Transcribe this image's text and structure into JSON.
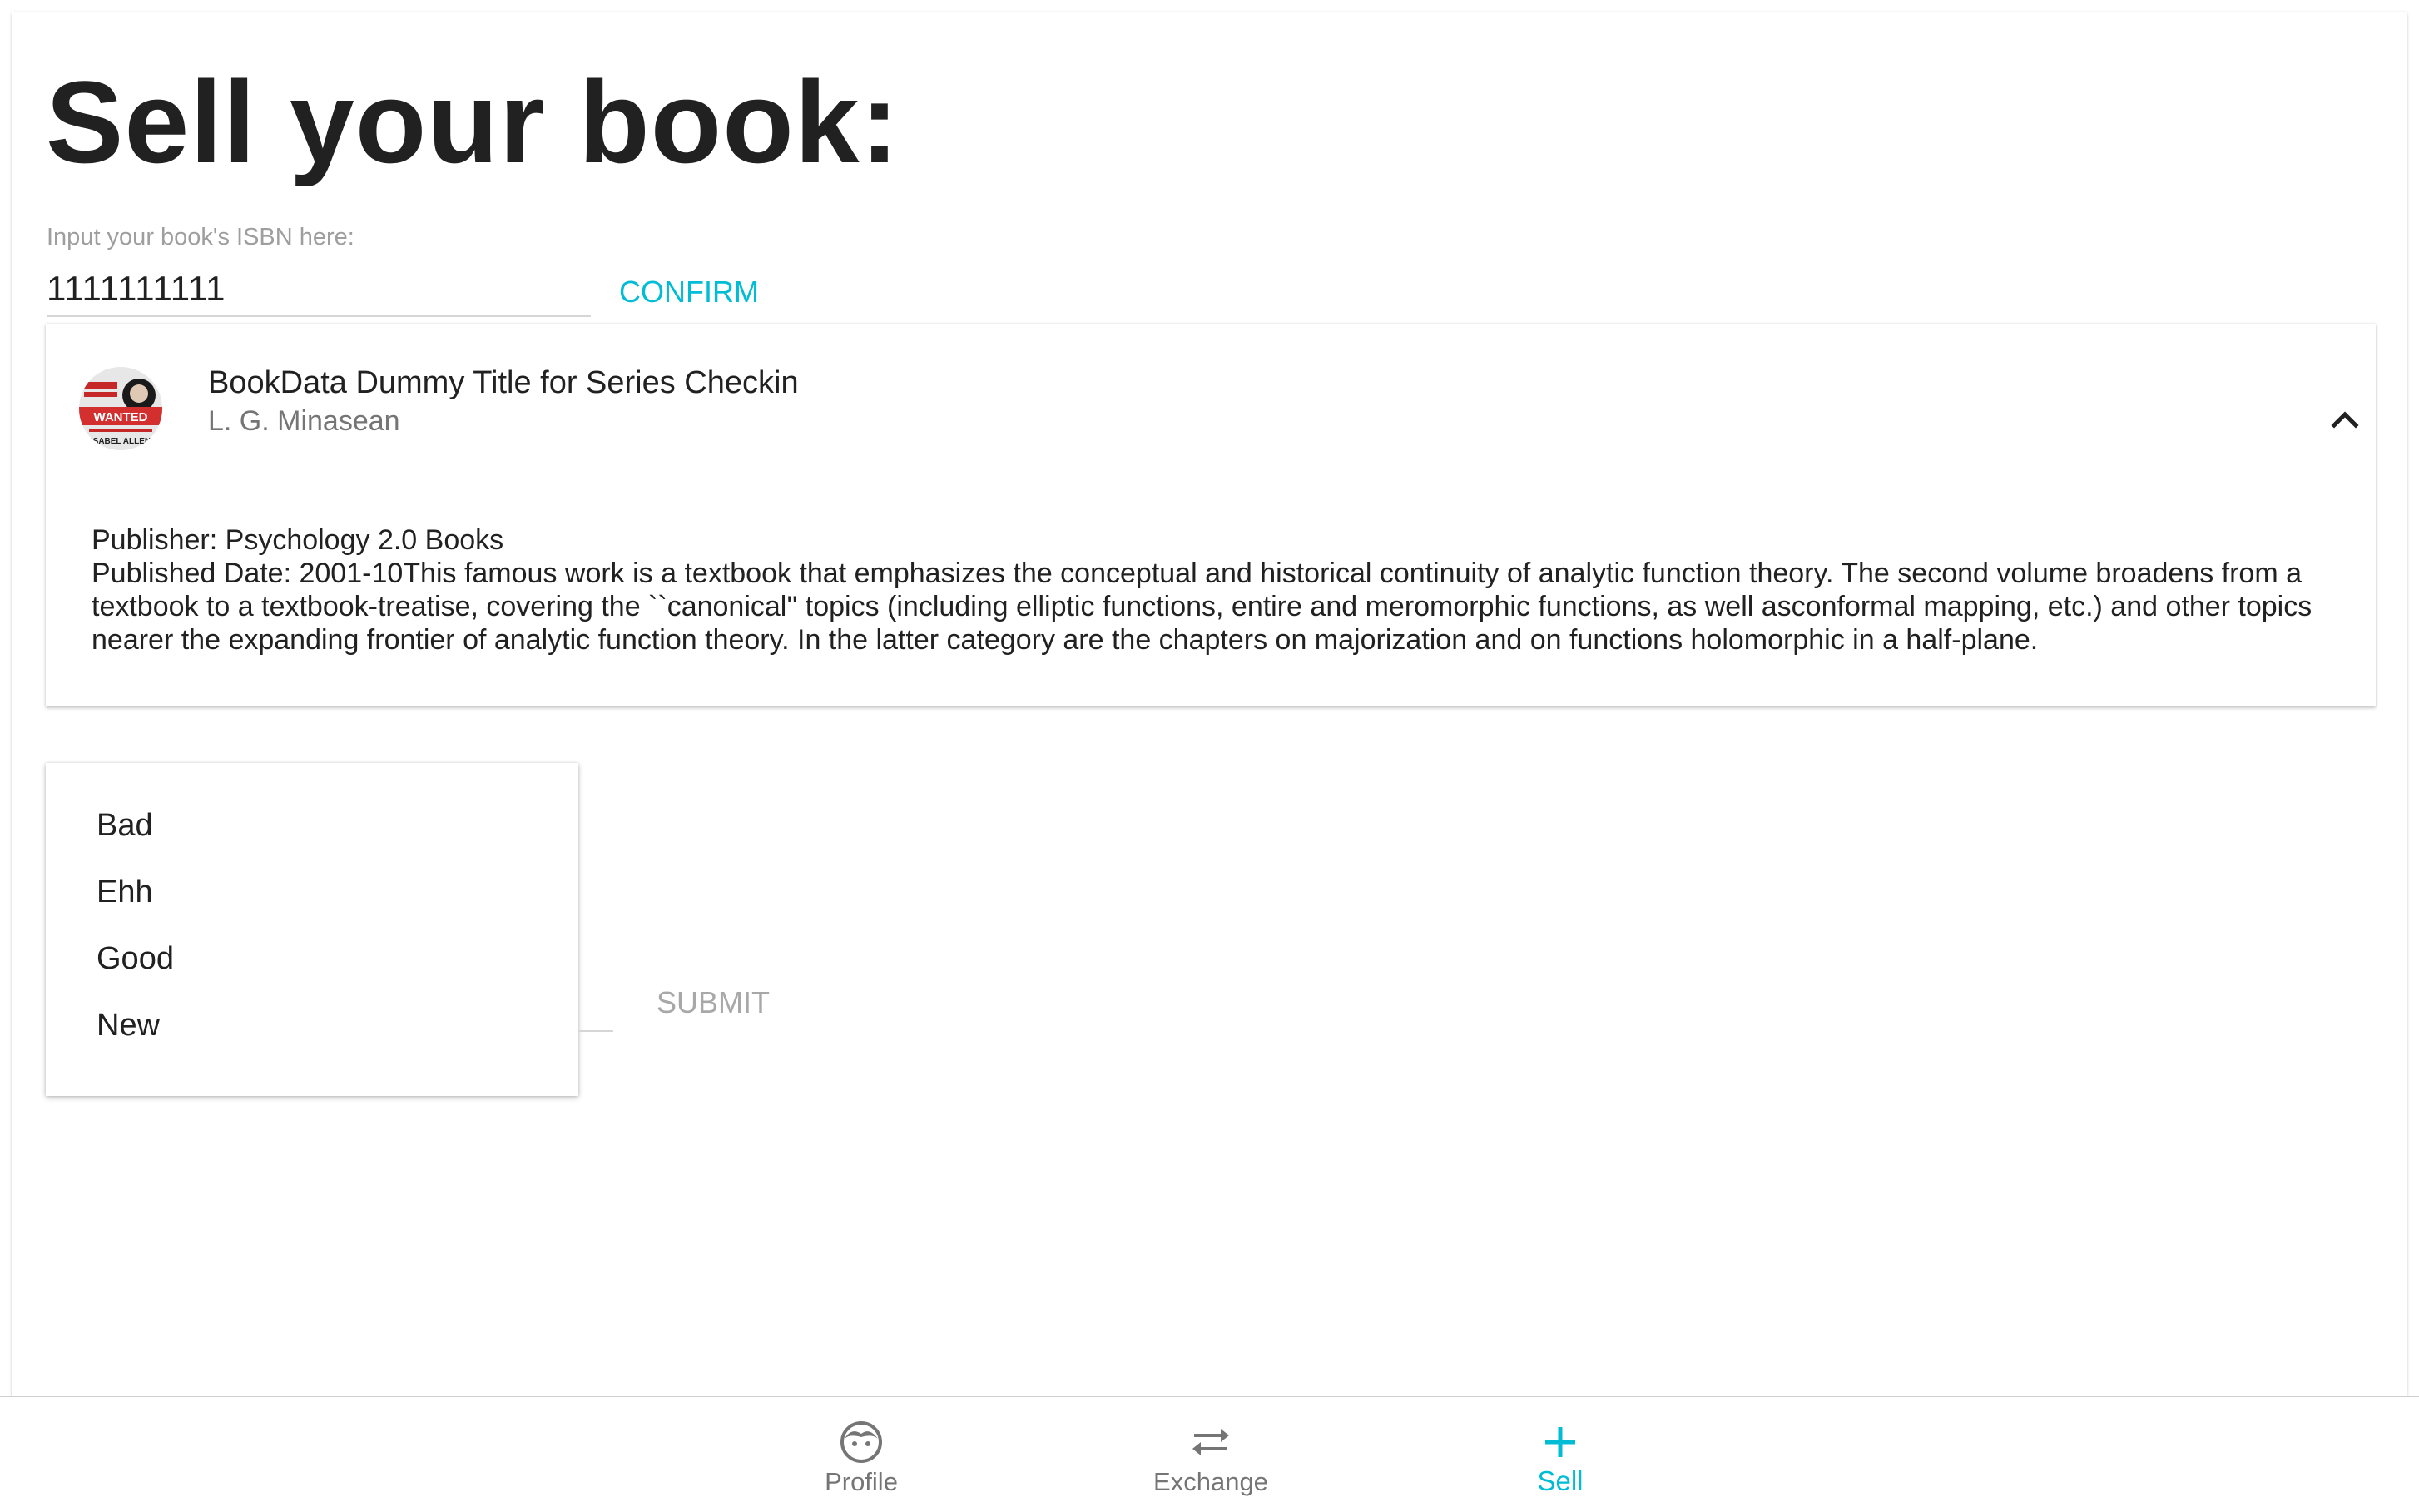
{
  "page": {
    "title": "Sell your book:"
  },
  "isbn": {
    "label": "Input your book's ISBN here:",
    "value": "1111111111",
    "confirm_label": "CONFIRM"
  },
  "book": {
    "title": "BookData Dummy Title for Series Checkin",
    "author": "L. G. Minasean",
    "publisher": "Publisher: Psychology 2.0 Books",
    "description": "Published Date: 2001-10This famous work is a textbook that emphasizes the conceptual and historical continuity of analytic function theory. The second volume broadens from a textbook to a textbook-treatise, covering the ``canonical'' topics (including elliptic functions, entire and meromorphic functions, as well asconformal mapping, etc.) and other topics nearer the expanding frontier of analytic function theory. In the latter category are the chapters on majorization and on functions holomorphic in a half-plane.",
    "cover_icon": "book-cover-thumbnail",
    "cover_lines": [
      "WANTED",
      "ISABEL ALLEN"
    ],
    "expand_icon": "chevron-up-icon"
  },
  "condition": {
    "options": [
      "Bad",
      "Ehh",
      "Good",
      "New"
    ]
  },
  "submit": {
    "label": "SUBMIT"
  },
  "nav": {
    "items": [
      {
        "label": "Profile",
        "icon": "face-icon"
      },
      {
        "label": "Exchange",
        "icon": "swap-arrows-icon"
      },
      {
        "label": "Sell",
        "icon": "plus-icon"
      }
    ],
    "active": "Sell"
  },
  "colors": {
    "accent": "#00bcd4",
    "text": "#212121",
    "muted": "#757575",
    "disabled": "#a8a8a8"
  }
}
